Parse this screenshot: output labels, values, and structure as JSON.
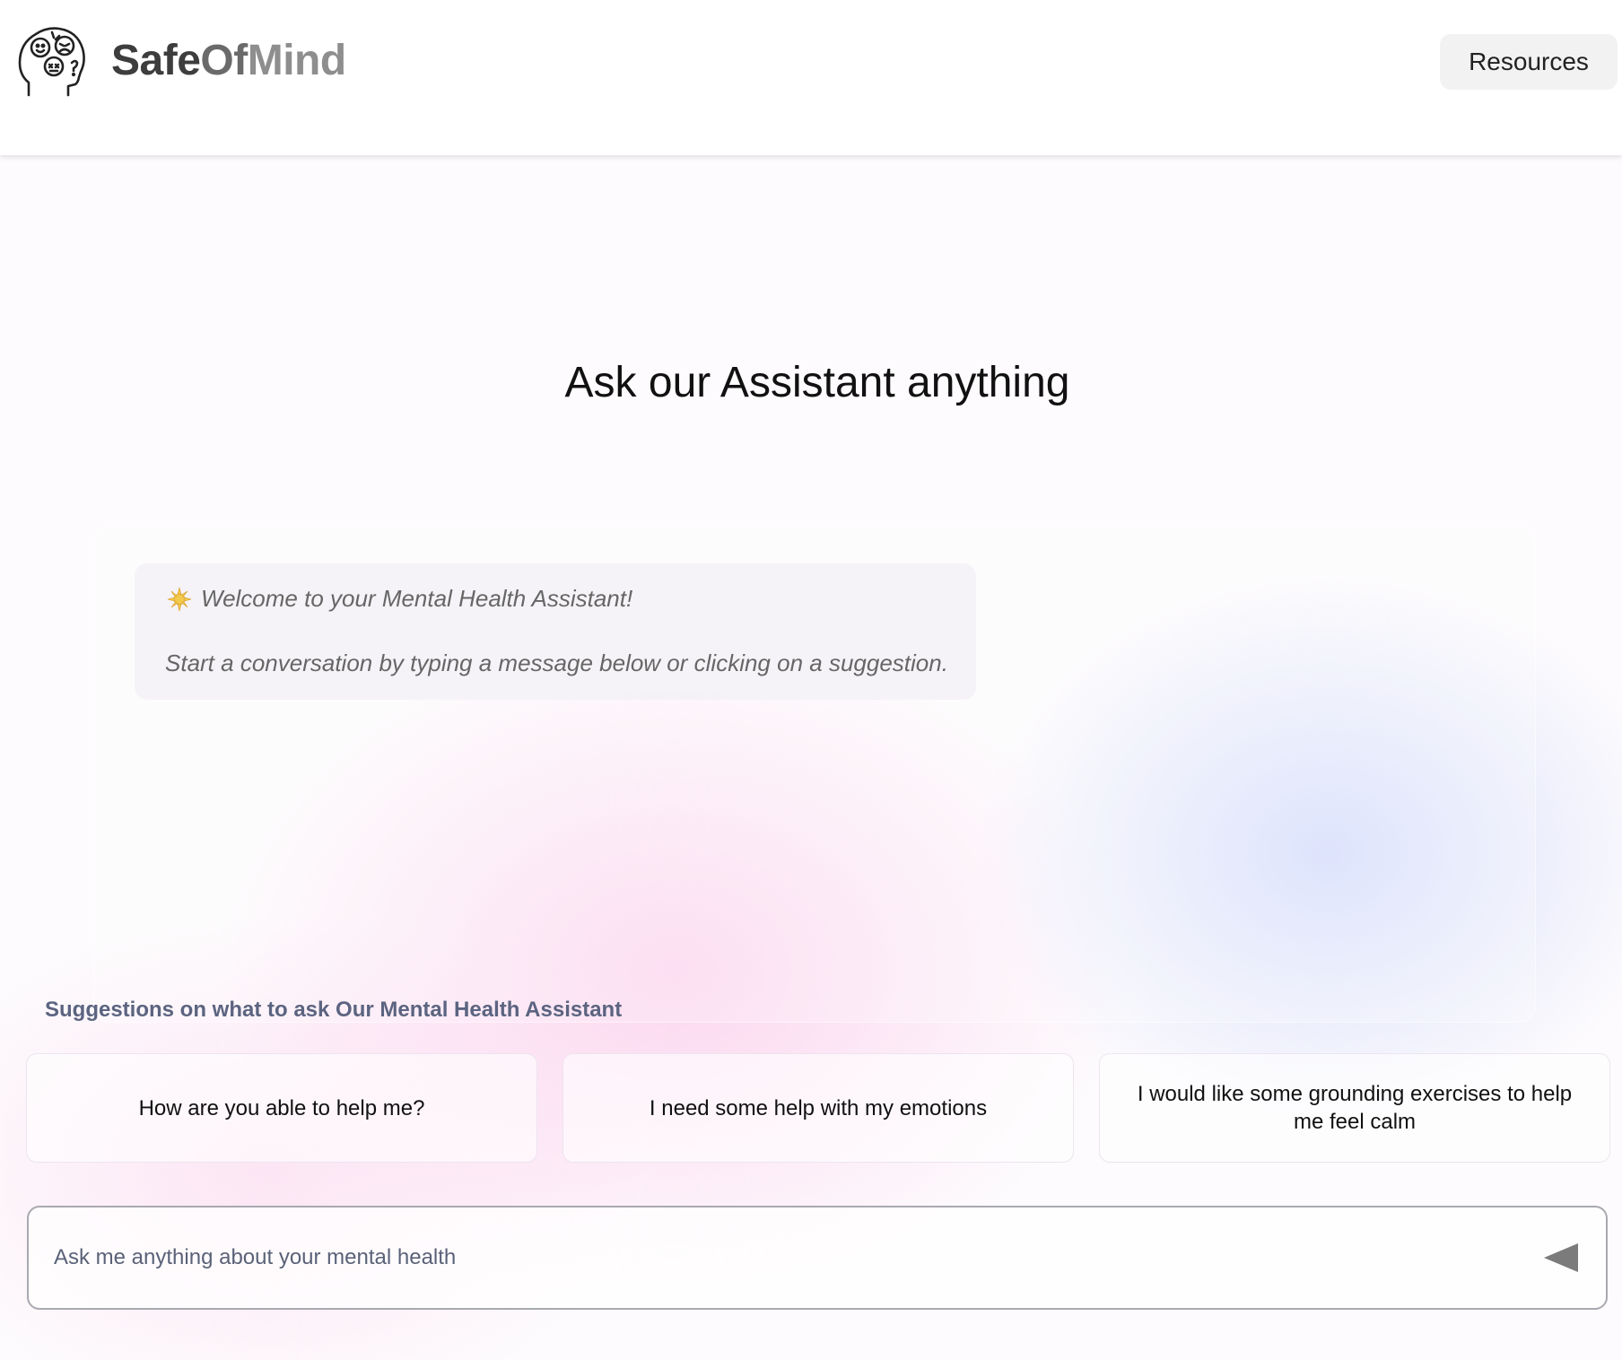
{
  "header": {
    "brand_part1": "Safe",
    "brand_part2": "Of",
    "brand_part3": "Mind",
    "resources_label": "Resources",
    "logo_icon": "head-with-emotions-icon"
  },
  "main": {
    "title": "Ask our Assistant anything"
  },
  "chat": {
    "welcome_title": "Welcome to your Mental Health Assistant!",
    "welcome_subtitle": "Start a conversation by typing a message below or clicking on a suggestion.",
    "welcome_icon": "sparkle-icon"
  },
  "suggestions": {
    "heading": "Suggestions on what to ask Our Mental Health Assistant",
    "items": [
      "How are you able to help me?",
      "I need some help with my emotions",
      "I would like some grounding exercises to help me feel calm"
    ]
  },
  "input": {
    "placeholder": "Ask me anything about your mental health",
    "value": "",
    "send_icon": "send-triangle-icon"
  },
  "colors": {
    "accent_pink": "#fcd4ee",
    "accent_blue": "#cdd7fa",
    "heading_slate": "#5b6480",
    "sparkle_gold": "#f2c94c"
  }
}
